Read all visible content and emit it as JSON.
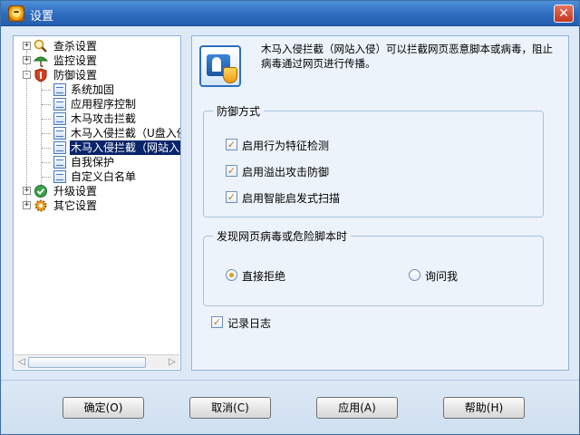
{
  "window": {
    "title": "设置",
    "close_glyph": "✕"
  },
  "tree": {
    "items": [
      {
        "label": "查杀设置",
        "expander": "+",
        "icon": "magnifier-icon"
      },
      {
        "label": "监控设置",
        "expander": "+",
        "icon": "umbrella-icon"
      },
      {
        "label": "防御设置",
        "expander": "-",
        "icon": "shield-icon"
      },
      {
        "label": "系统加固",
        "icon": "doc-icon"
      },
      {
        "label": "应用程序控制",
        "icon": "doc-icon"
      },
      {
        "label": "木马攻击拦截",
        "icon": "doc-icon"
      },
      {
        "label": "木马入侵拦截（U盘入侵",
        "icon": "doc-icon"
      },
      {
        "label": "木马入侵拦截（网站入",
        "icon": "doc-icon",
        "selected": true
      },
      {
        "label": "自我保护",
        "icon": "doc-icon"
      },
      {
        "label": "自定义白名单",
        "icon": "doc-icon"
      },
      {
        "label": "升级设置",
        "expander": "+",
        "icon": "globe-check-icon"
      },
      {
        "label": "其它设置",
        "expander": "+",
        "icon": "gear-icon"
      }
    ],
    "scroll_left": "◁",
    "scroll_right": "▷"
  },
  "panel": {
    "description": "木马入侵拦截（网站入侵）可以拦截网页恶意脚本或病毒，阻止病毒通过网页进行传播。",
    "defense_group": {
      "legend": "防御方式",
      "options": [
        {
          "label": "启用行为特征检测",
          "checked": true
        },
        {
          "label": "启用溢出攻击防御",
          "checked": true
        },
        {
          "label": "启用智能启发式扫描",
          "checked": true
        }
      ]
    },
    "action_group": {
      "legend": "发现网页病毒或危险脚本时",
      "options": [
        {
          "label": "直接拒绝",
          "selected": true
        },
        {
          "label": "询问我",
          "selected": false
        }
      ]
    },
    "log": {
      "label": "记录日志",
      "checked": true
    },
    "check_glyph": "✓"
  },
  "buttons": {
    "ok": "确定(O)",
    "cancel": "取消(C)",
    "apply": "应用(A)",
    "help": "帮助(H)"
  },
  "colors": {
    "selection": "#0a246a",
    "titlebar": "#2d6bbf",
    "check": "#c0781a",
    "radio_dot": "#e39a24"
  }
}
